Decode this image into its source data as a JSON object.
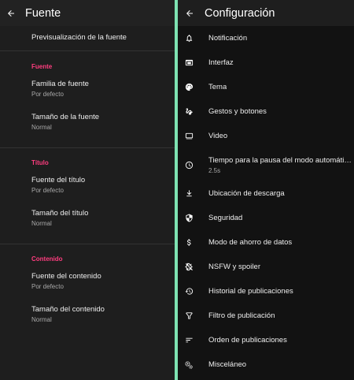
{
  "left": {
    "title": "Fuente",
    "preview_label": "Previsualización de la fuente",
    "sections": [
      {
        "category": "Fuente",
        "items": [
          {
            "title": "Familia de fuente",
            "value": "Por defecto"
          },
          {
            "title": "Tamaño de la fuente",
            "value": "Normal"
          }
        ]
      },
      {
        "category": "Título",
        "items": [
          {
            "title": "Fuente del título",
            "value": "Por defecto"
          },
          {
            "title": "Tamaño del título",
            "value": "Normal"
          }
        ]
      },
      {
        "category": "Contenido",
        "items": [
          {
            "title": "Fuente del contenido",
            "value": "Por defecto"
          },
          {
            "title": "Tamaño del contenido",
            "value": "Normal"
          }
        ]
      }
    ]
  },
  "right": {
    "title": "Configuración",
    "items": [
      {
        "label": "Notificación",
        "icon": "bell-icon"
      },
      {
        "label": "Interfaz",
        "icon": "window-icon"
      },
      {
        "label": "Tema",
        "icon": "palette-icon"
      },
      {
        "label": "Gestos y botones",
        "icon": "gesture-icon"
      },
      {
        "label": "Video",
        "icon": "monitor-icon"
      },
      {
        "label": "Tiempo para la pausa del modo automáti…",
        "sub": "2.5s",
        "icon": "clock-icon"
      },
      {
        "label": "Ubicación de descarga",
        "icon": "download-icon"
      },
      {
        "label": "Seguridad",
        "icon": "shield-icon"
      },
      {
        "label": "Modo de ahorro de datos",
        "icon": "dollar-icon"
      },
      {
        "label": "NSFW y spoiler",
        "icon": "nsfw-icon"
      },
      {
        "label": "Historial de publicaciones",
        "icon": "history-icon"
      },
      {
        "label": "Filtro de publicación",
        "icon": "filter-icon"
      },
      {
        "label": "Orden de publicaciones",
        "icon": "sort-icon"
      },
      {
        "label": "Misceláneo",
        "icon": "settings-icon"
      }
    ]
  },
  "colors": {
    "accent_category": "#ff3d7f",
    "divider": "#7ee2b2"
  }
}
